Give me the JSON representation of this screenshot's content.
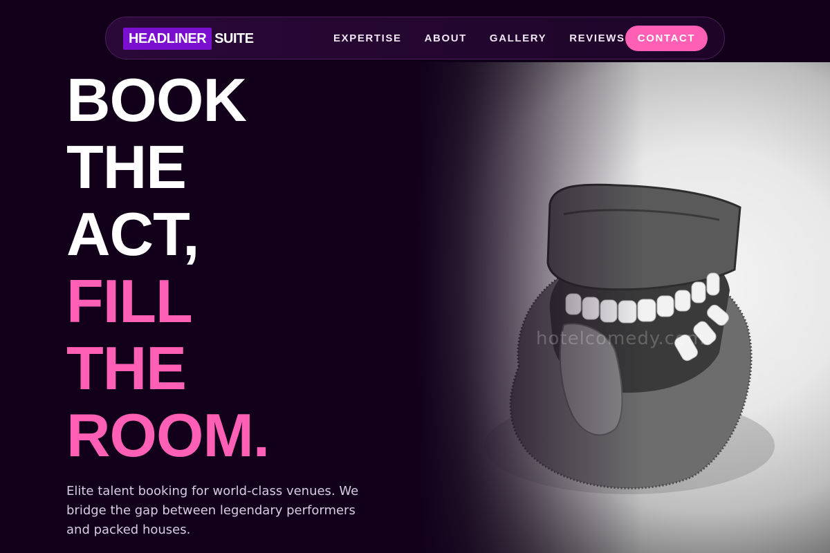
{
  "nav": {
    "logo_highlight": "HEADLINER",
    "logo_rest": "SUITE",
    "links": [
      "EXPERTISE",
      "ABOUT",
      "GALLERY",
      "REVIEWS"
    ],
    "contact_label": "CONTACT"
  },
  "hero": {
    "headline_white": [
      "BOOK",
      "THE",
      "ACT,"
    ],
    "headline_pink": [
      "FILL",
      "THE",
      "ROOM."
    ],
    "subtext": "Elite talent booking for world-class venues. We bridge the gap between legendary performers and packed houses.",
    "image_watermark": "hotelcomedy.com"
  },
  "colors": {
    "background": "#12001a",
    "accent_pink": "#ff5fb4",
    "logo_purple": "#7a0fd0"
  }
}
